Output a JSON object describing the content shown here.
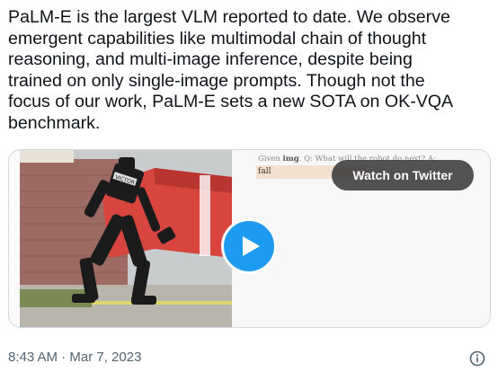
{
  "tweet": {
    "text_lines": [
      "PaLM-E is the largest VLM reported to date.  We observe",
      "emergent capabilities like multimodal chain of thought",
      "reasoning, and multi-image inference, despite being",
      "trained on only single-image prompts. Though not the",
      "focus of our work, PaLM-E sets a new SOTA on OK-VQA",
      "benchmark."
    ],
    "timestamp": "8:43 AM · Mar 7, 2023"
  },
  "media": {
    "prompt_prefix": "Given ",
    "prompt_img": "img",
    "prompt_suffix": ". Q: What will the robot do next? A:",
    "answer": "fall",
    "watch_label": "Watch on Twitter",
    "robot_label": "VICTOR"
  },
  "icons": {
    "play": "play-icon",
    "info": "info-icon"
  },
  "colors": {
    "accent": "#1d9bf0",
    "text": "#0f1419",
    "muted": "#536471",
    "answer_highlight": "#f4e0cf"
  }
}
